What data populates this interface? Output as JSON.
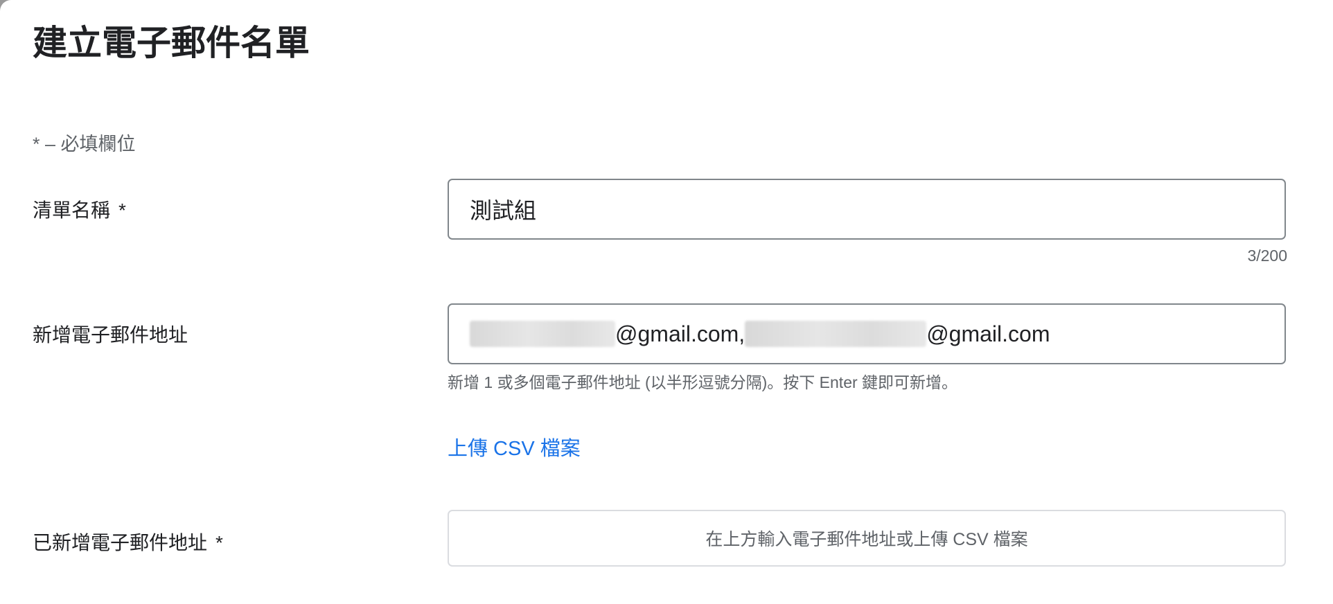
{
  "dialog": {
    "title": "建立電子郵件名單",
    "required_note": "* – 必填欄位"
  },
  "list_name": {
    "label": "清單名稱",
    "required_mark": "*",
    "value": "測試組",
    "counter": "3/200"
  },
  "add_emails": {
    "label": "新增電子郵件地址",
    "email_1_suffix": "@gmail.com,",
    "email_2_suffix": "@gmail.com",
    "helper": "新增 1 或多個電子郵件地址 (以半形逗號分隔)。按下 Enter 鍵即可新增。",
    "upload_link": "上傳 CSV 檔案"
  },
  "added_emails": {
    "label": "已新增電子郵件地址",
    "required_mark": "*",
    "placeholder": "在上方輸入電子郵件地址或上傳 CSV 檔案"
  },
  "colors": {
    "link": "#1a73e8",
    "text": "#202124",
    "secondary_text": "#5f6368",
    "border": "#80868b"
  }
}
